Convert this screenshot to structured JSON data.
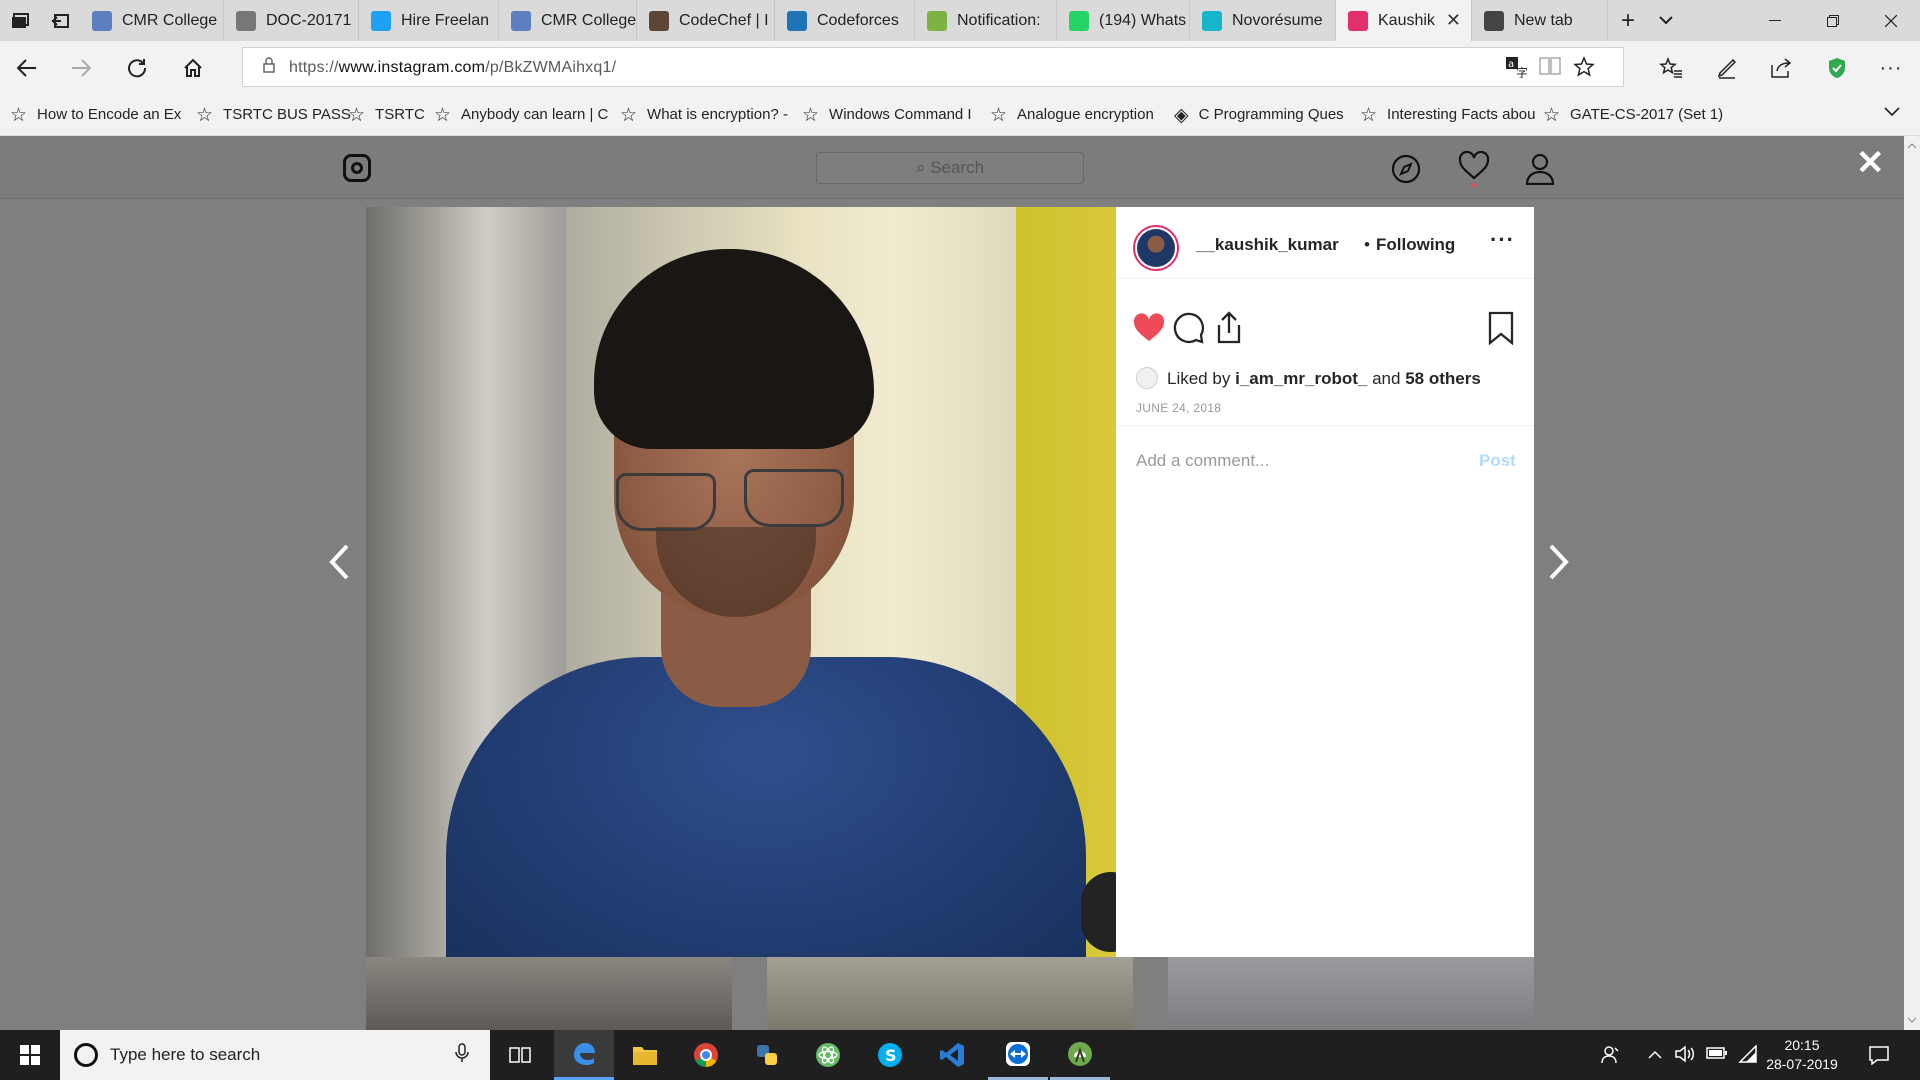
{
  "browser": {
    "tabs": [
      {
        "label": "CMR College",
        "icon": "college-favicon",
        "color": "#5c7fbf"
      },
      {
        "label": "DOC-20171",
        "icon": "pdf-favicon",
        "color": "#777777"
      },
      {
        "label": "Hire Freelan",
        "icon": "twitter-favicon",
        "color": "#1da1f2"
      },
      {
        "label": "CMR College",
        "icon": "college-favicon",
        "color": "#5c7fbf"
      },
      {
        "label": "CodeChef | I",
        "icon": "codechef-favicon",
        "color": "#5b4638"
      },
      {
        "label": "Codeforces",
        "icon": "codeforces-favicon",
        "color": "#1f74b6"
      },
      {
        "label": "Notification:",
        "icon": "android-favicon",
        "color": "#7cb342"
      },
      {
        "label": "(194) Whats",
        "icon": "whatsapp-favicon",
        "color": "#25d366"
      },
      {
        "label": "Novorésume",
        "icon": "novoresume-favicon",
        "color": "#17b5c9"
      },
      {
        "label": "Kaushik",
        "icon": "instagram-favicon",
        "color": "#e1306c",
        "active": true
      },
      {
        "label": "New tab",
        "icon": "new-tab-favicon",
        "color": "#444444"
      }
    ],
    "url_prefix": "https://",
    "url_domain": "www.instagram.com",
    "url_path": "/p/BkZWMAihxq1/",
    "favorites": [
      "How to Encode an Ex",
      "TSRTC BUS PASS",
      "TSRTC",
      "Anybody can learn | C",
      "What is encryption? -",
      "Windows Command I",
      "Analogue encryption",
      "C Programming Ques",
      "Interesting Facts abou",
      "GATE-CS-2017 (Set 1)"
    ]
  },
  "instagram": {
    "search_placeholder": "Search",
    "post": {
      "username": "__kaushik_kumar",
      "separator": "•",
      "follow_status": "Following",
      "liked_prefix": "Liked by",
      "liked_user": "i_am_mr_robot_",
      "liked_and": "and",
      "liked_others": "58 others",
      "date": "JUNE 24, 2018",
      "comment_placeholder": "Add a comment...",
      "post_button": "Post",
      "liked": true
    }
  },
  "colors": {
    "heart": "#ed4956",
    "avatar_ring": "#e1306c",
    "post_link": "#b3dbff",
    "edge_accent": "#2b7cd6"
  },
  "taskbar": {
    "search_placeholder": "Type here to search",
    "apps": [
      "task-view-icon",
      "edge-icon",
      "file-explorer-icon",
      "chrome-icon",
      "python-icon",
      "atom-icon",
      "skype-icon",
      "vscode-icon",
      "teamviewer-icon",
      "android-studio-icon"
    ],
    "time": "20:15",
    "date": "28-07-2019"
  }
}
